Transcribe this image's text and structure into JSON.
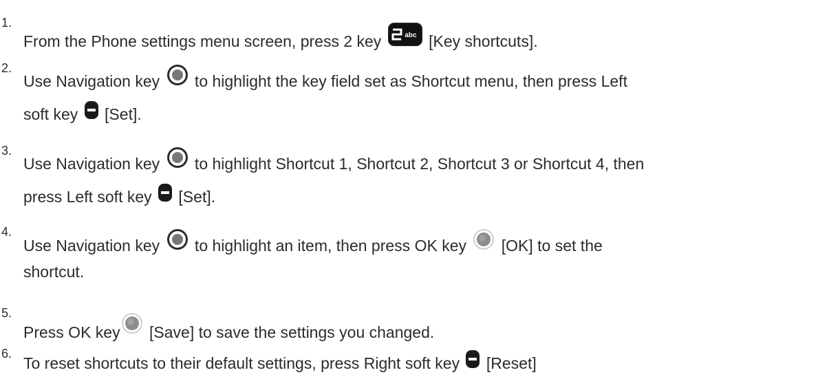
{
  "steps": [
    {
      "number": "1.",
      "lines": [
        [
          {
            "text": "From the Phone settings menu screen, press 2 key "
          },
          {
            "icon": "key-2abc-icon"
          },
          {
            "text": " [Key shortcuts]."
          }
        ]
      ]
    },
    {
      "number": "2.",
      "lines": [
        [
          {
            "text": "Use Navigation key "
          },
          {
            "icon": "navigation-key-icon"
          },
          {
            "text": " to highlight the key field set as Shortcut menu, then press Left"
          }
        ],
        [
          {
            "text": "soft key "
          },
          {
            "icon": "left-soft-key-icon"
          },
          {
            "text": " [Set]."
          }
        ]
      ]
    },
    {
      "number": "3.",
      "lines": [
        [
          {
            "text": "Use Navigation key "
          },
          {
            "icon": "navigation-key-icon"
          },
          {
            "text": " to highlight Shortcut 1, Shortcut 2, Shortcut 3 or Shortcut 4, then"
          }
        ],
        [
          {
            "text": "press Left soft key "
          },
          {
            "icon": "left-soft-key-icon"
          },
          {
            "text": " [Set]."
          }
        ]
      ]
    },
    {
      "number": "4.",
      "lines": [
        [
          {
            "text": "Use Navigation key "
          },
          {
            "icon": "navigation-key-icon"
          },
          {
            "text": " to highlight an item, then press OK key "
          },
          {
            "icon": "ok-key-icon"
          },
          {
            "text": " [OK] to set the"
          }
        ],
        [
          {
            "text": "shortcut."
          }
        ]
      ]
    },
    {
      "number": "5.",
      "lines": [
        [
          {
            "text": "Press OK key"
          },
          {
            "icon": "ok-key-icon"
          },
          {
            "text": " [Save] to save the settings you changed."
          }
        ]
      ]
    },
    {
      "number": "6.",
      "lines": [
        [
          {
            "text": "To reset shortcuts to their default settings, press Right soft key "
          },
          {
            "icon": "right-soft-key-icon"
          },
          {
            "text": " [Reset]"
          }
        ]
      ]
    }
  ]
}
